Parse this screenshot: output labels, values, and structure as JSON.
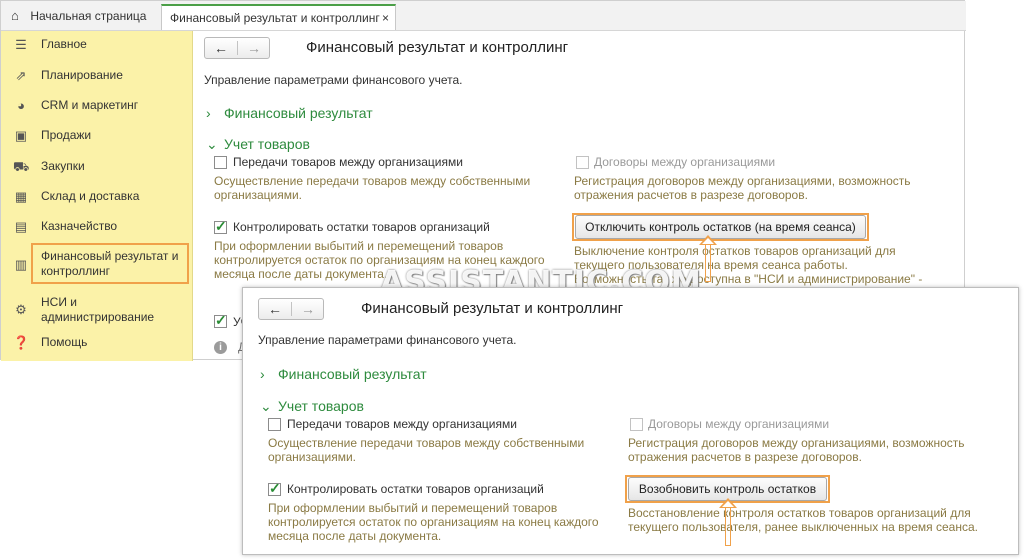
{
  "tabs": {
    "home": "Начальная страница",
    "active": "Финансовый результат и контроллинг",
    "close": "×"
  },
  "sidebar": {
    "items": [
      {
        "label": "Главное",
        "icon": "menu-icon"
      },
      {
        "label": "Планирование",
        "icon": "chart-up-icon"
      },
      {
        "label": "CRM и маркетинг",
        "icon": "pie-chart-icon"
      },
      {
        "label": "Продажи",
        "icon": "shopping-bag-icon"
      },
      {
        "label": "Закупки",
        "icon": "cart-icon"
      },
      {
        "label": "Склад и доставка",
        "icon": "warehouse-icon"
      },
      {
        "label": "Казначейство",
        "icon": "wallet-icon"
      },
      {
        "label": "Финансовый результат и контроллинг",
        "icon": "bar-chart-icon"
      },
      {
        "label": "НСИ и администрирование",
        "icon": "gear-icon"
      },
      {
        "label": "Помощь",
        "icon": "help-icon"
      }
    ],
    "accent": "#f0a14a"
  },
  "nav": {
    "back": "←",
    "forward": "→"
  },
  "page": {
    "title": "Финансовый результат и контроллинг",
    "subtitle": "Управление параметрами финансового учета.",
    "group_fin": "Финансовый результат",
    "group_goods": "Учет товаров",
    "cb_transfers": "Передачи товаров между организациями",
    "cb_transfers_desc1": "Осуществление передачи товаров между собственными",
    "cb_transfers_desc2": "организациями.",
    "cb_contracts": "Договоры между организациями",
    "cb_contracts_desc1": "Регистрация договоров между организациями, возможность",
    "cb_contracts_desc2": "отражения расчетов  в разрезе договоров.",
    "cb_control": "Контролировать остатки товаров организаций",
    "cb_control_desc1": "При оформлении выбытий и перемещений товаров",
    "cb_control_desc2": "контролируется остаток по организациям на конец каждого",
    "cb_control_desc3": "месяца после даты документа."
  },
  "window1": {
    "button": "Отключить контроль остатков (на время сеанса)",
    "btn_desc1": "Выключение контроля остатков товаров организаций для",
    "btn_desc2": "текущего пользователя на время сеанса работы.",
    "btn_desc3": "Возможность так же доступна в \"НСИ и администрирование\" -",
    "btn_desc4": "\" ... \"",
    "partial_cb": "Уч",
    "partial_info": "Д"
  },
  "window2": {
    "button": "Возобновить контроль остатков",
    "btn_desc1": "Восстановление контроля остатков товаров организаций для",
    "btn_desc2": "текущего пользователя, ранее выключенных на время сеанса."
  },
  "watermark": "ASSISTANTIC.COM",
  "colors": {
    "green": "#2e8b3e",
    "sidebar": "#fbf2a8",
    "highlight": "#f0a14a",
    "desc": "#8a7a44"
  }
}
